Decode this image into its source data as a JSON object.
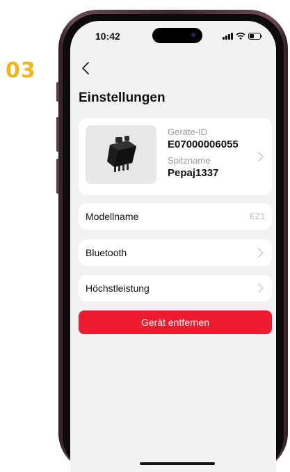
{
  "step_number": "03",
  "status_bar": {
    "time": "10:42"
  },
  "header": {
    "title": "Einstellungen"
  },
  "device": {
    "id_label": "Geräte-ID",
    "id_value": "E07000006055",
    "nickname_label": "Spitzname",
    "nickname_value": "Pepaj1337"
  },
  "settings": {
    "model": {
      "label": "Modellname",
      "value": "EZ1"
    },
    "bluetooth": {
      "label": "Bluetooth"
    },
    "max_power": {
      "label": "Höchstleistung"
    }
  },
  "actions": {
    "remove_device": "Gerät entfernen"
  },
  "colors": {
    "accent_red": "#ee1c2e",
    "step_yellow": "#f2b418",
    "screen_bg": "#f2f2f4"
  }
}
